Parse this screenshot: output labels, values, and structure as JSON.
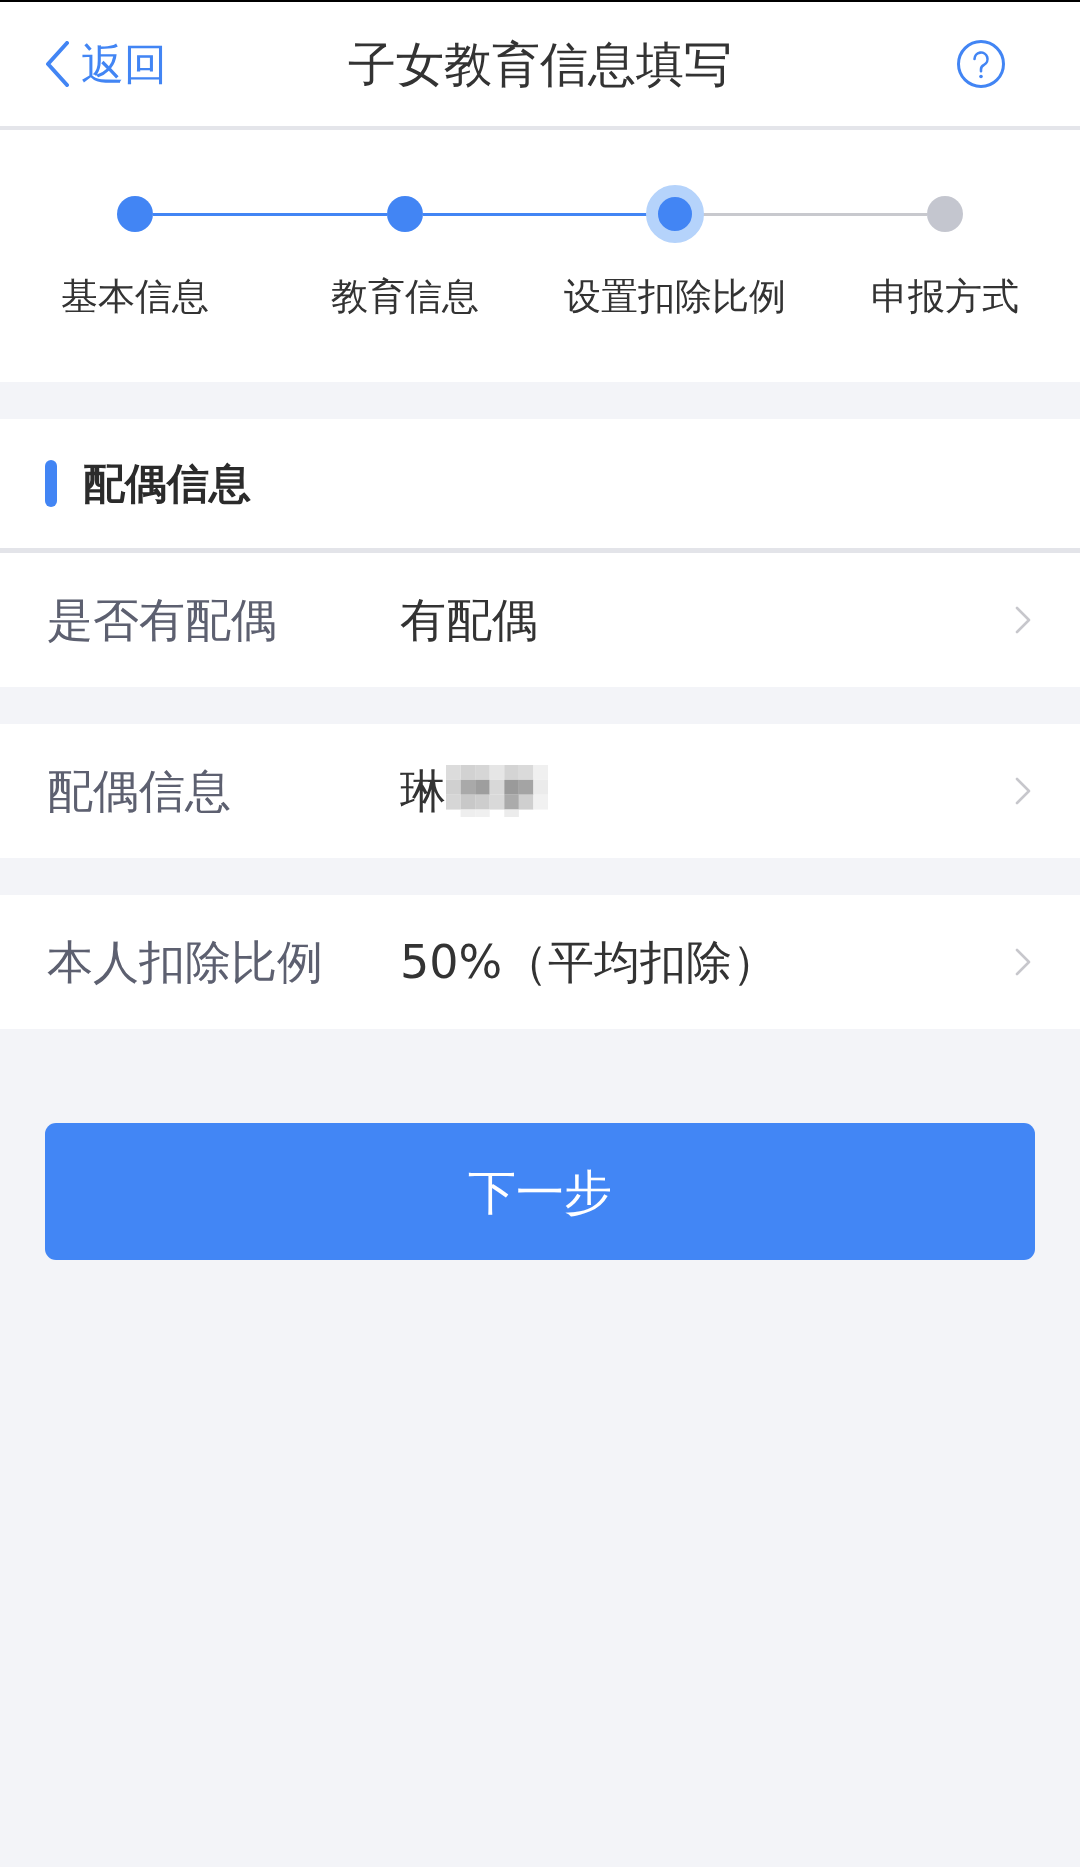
{
  "nav": {
    "back_label": "返回",
    "title": "子女教育信息填写"
  },
  "steps": [
    {
      "label": "基本信息",
      "completed": true,
      "selected": false
    },
    {
      "label": "教育信息",
      "completed": true,
      "selected": false
    },
    {
      "label": "设置扣除比例",
      "completed": false,
      "selected": true
    },
    {
      "label": "申报方式",
      "completed": false,
      "selected": false
    }
  ],
  "groups": [
    {
      "title": "配偶信息",
      "rows": [
        {
          "label": "是否有配偶",
          "value": "有配偶",
          "redacted": false
        }
      ]
    },
    {
      "rows": [
        {
          "label": "配偶信息",
          "value": "琳",
          "redacted": true
        }
      ]
    },
    {
      "rows": [
        {
          "label": "本人扣除比例",
          "value": "50%（平均扣除）",
          "redacted": false
        }
      ]
    }
  ],
  "next_button": {
    "label": "下一步"
  }
}
